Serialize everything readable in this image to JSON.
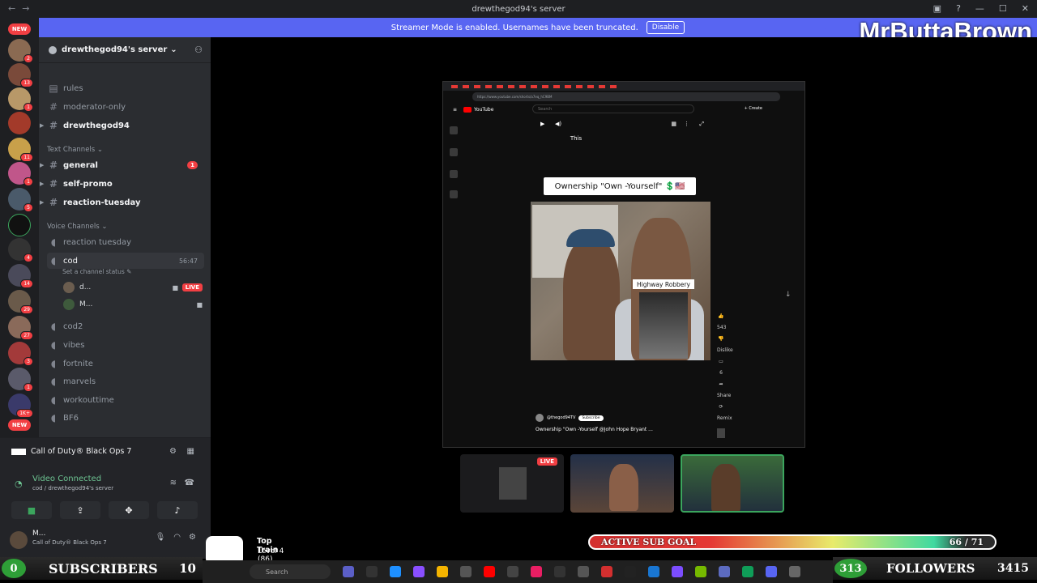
{
  "window": {
    "title": "drewthegod94's server"
  },
  "streamer_banner": {
    "text": "Streamer Mode is enabled. Usernames have been truncated.",
    "button": "Disable"
  },
  "brand": {
    "name": "MrButtaBrown",
    "color": "#5865f2"
  },
  "guild_badges": {
    "new_top": "NEW",
    "new_bottom": "NEW",
    "counts": [
      "2",
      "13",
      "1",
      "11",
      "1",
      "5",
      "4",
      "14",
      "29",
      "27",
      "3",
      "1",
      "1K+"
    ]
  },
  "server": {
    "name": "drewthegod94's server"
  },
  "channels": {
    "top": [
      {
        "name": "rules",
        "icon": "rules-icon"
      },
      {
        "name": "moderator-only",
        "icon": "hash-icon"
      },
      {
        "name": "drewthegod94",
        "icon": "hash-icon"
      }
    ],
    "text_category": "Text Channels",
    "text": [
      {
        "name": "general",
        "badge": "1"
      },
      {
        "name": "self-promo"
      },
      {
        "name": "reaction-tuesday"
      }
    ],
    "voice_category": "Voice Channels",
    "voice_first": "reaction tuesday",
    "active_voice": {
      "name": "cod",
      "time": "56:47",
      "status": "Set a channel status"
    },
    "voice_users": [
      {
        "name": "d...",
        "live": "LIVE"
      },
      {
        "name": "M..."
      }
    ],
    "voice_rest": [
      "cod2",
      "vibes",
      "fortnite",
      "marvels",
      "workouttime",
      "BF6"
    ]
  },
  "voice_panel": {
    "activity": "Call of Duty® Black Ops 7",
    "status": "Video Connected",
    "location": "cod / drewthegod94's server"
  },
  "user_panel": {
    "name": "M...",
    "status": "Call of Duty® Black Ops 7"
  },
  "stream": {
    "url": "https://www.youtube.com/shorts/a7eq_hC9BM",
    "youtube_label": "YouTube",
    "search_placeholder": "Search",
    "create_label": "+ Create",
    "overlay_text": "This",
    "caption": "Ownership \"Own -Yourself\" 💲🇺🇸",
    "inset_label": "Highway Robbery",
    "channel_handle": "@thegod94TV",
    "subscribe": "Subscribe",
    "video_title": "Ownership \"Own -Yourself @John Hope Bryant ...",
    "actions": [
      "543",
      "Dislike",
      "6",
      "Share",
      "Remix"
    ]
  },
  "tiles": {
    "live": "LIVE"
  },
  "overlay": {
    "sub_goal_label": "ACTIVE SUB GOAL",
    "sub_goal_value": "66 / 71",
    "sub_goal_progress": 0.93,
    "subscribers_count": "0",
    "subscribers_label": "SUBSCRIBERS",
    "subscribers_total": "10",
    "followers_count": "313",
    "followers_label": "FOLLOWERS",
    "followers_total": "3415",
    "top_train_title": "Top Train",
    "top_train_level": "Level 4 (86)"
  },
  "taskbar": {
    "search": "Search"
  }
}
